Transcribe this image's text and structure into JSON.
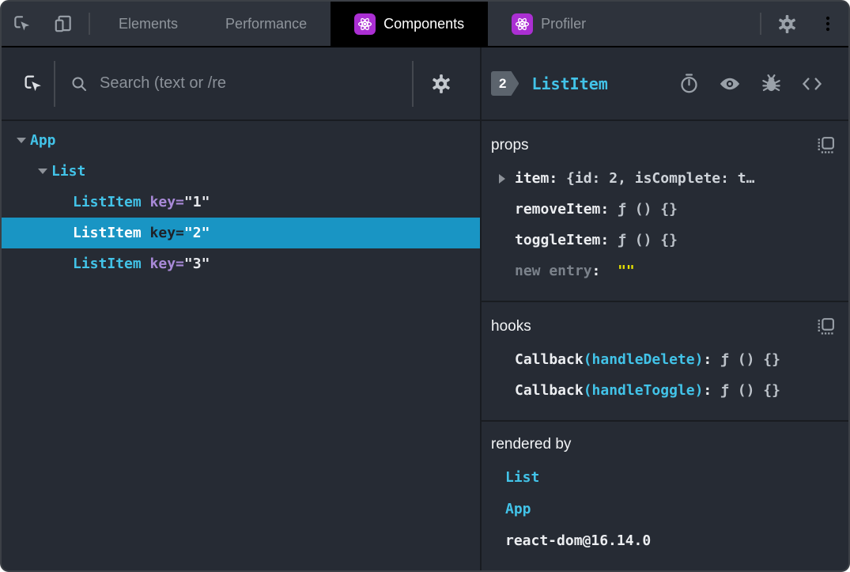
{
  "colors": {
    "panel_bg": "#262b34",
    "topbar_bg": "#2e333c",
    "active_tab_bg": "#000000",
    "selection_bg": "#1995c4",
    "component_cyan": "#42c3e8",
    "attribute_purple": "#a98ad8",
    "string_yellow": "#e9e400",
    "react_brand_purple": "#ab2fd3",
    "icon_gray": "#9aa1a9"
  },
  "topbar": {
    "icons_left": [
      "inspect-element-icon",
      "toggle-device-toolbar-icon"
    ],
    "tabs": [
      {
        "label": "Elements",
        "active": false,
        "react_icon": false
      },
      {
        "label": "Performance",
        "active": false,
        "react_icon": false
      },
      {
        "label": "Components",
        "active": true,
        "react_icon": true
      },
      {
        "label": "Profiler",
        "active": false,
        "react_icon": true
      }
    ],
    "icons_right": [
      "settings-icon",
      "more-options-icon"
    ]
  },
  "left_panel": {
    "toolbar": {
      "search_placeholder": "Search (text or /re",
      "search_value": ""
    },
    "tree": [
      {
        "name": "App",
        "depth": 0,
        "expanded": true,
        "selected": false
      },
      {
        "name": "List",
        "depth": 1,
        "expanded": true,
        "selected": false
      },
      {
        "name": "ListItem",
        "depth": 2,
        "attr": "key=",
        "value": "\"1\"",
        "selected": false
      },
      {
        "name": "ListItem",
        "depth": 2,
        "attr": "key=",
        "value": "\"2\"",
        "selected": true
      },
      {
        "name": "ListItem",
        "depth": 2,
        "attr": "key=",
        "value": "\"3\"",
        "selected": false
      }
    ]
  },
  "right_panel": {
    "header": {
      "badge": "2",
      "title": "ListItem",
      "icons": [
        "stopwatch-icon",
        "eye-icon",
        "bug-icon",
        "view-source-icon"
      ]
    },
    "sections": [
      {
        "title": "props",
        "copy_icon": true,
        "rows": [
          {
            "arrow": true,
            "parts": [
              {
                "text": "item",
                "cls": "name"
              },
              {
                "text": ": ",
                "cls": "name"
              },
              {
                "text": "{id: 2, isComplete: t…",
                "cls": "preview"
              }
            ]
          },
          {
            "arrow": false,
            "parts": [
              {
                "text": "removeItem",
                "cls": "name"
              },
              {
                "text": ": ",
                "cls": "name"
              },
              {
                "text": "ƒ () {}",
                "cls": "fn"
              }
            ]
          },
          {
            "arrow": false,
            "parts": [
              {
                "text": "toggleItem",
                "cls": "name"
              },
              {
                "text": ": ",
                "cls": "name"
              },
              {
                "text": "ƒ () {}",
                "cls": "fn"
              }
            ]
          },
          {
            "arrow": false,
            "parts": [
              {
                "text": "new entry",
                "cls": "newentry"
              },
              {
                "text": ":  ",
                "cls": "name"
              },
              {
                "text": "\"\"",
                "cls": "yellow"
              }
            ]
          }
        ]
      },
      {
        "title": "hooks",
        "copy_icon": true,
        "rows": [
          {
            "arrow": false,
            "parts": [
              {
                "text": "Callback",
                "cls": "name"
              },
              {
                "text": "(handleDelete)",
                "cls": "cyan"
              },
              {
                "text": ": ",
                "cls": "name"
              },
              {
                "text": "ƒ () {}",
                "cls": "fn"
              }
            ]
          },
          {
            "arrow": false,
            "parts": [
              {
                "text": "Callback",
                "cls": "name"
              },
              {
                "text": "(handleToggle)",
                "cls": "cyan"
              },
              {
                "text": ": ",
                "cls": "name"
              },
              {
                "text": "ƒ () {}",
                "cls": "fn"
              }
            ]
          }
        ]
      },
      {
        "title": "rendered by",
        "copy_icon": false,
        "rows": [
          {
            "arrow": false,
            "link": true,
            "parts": [
              {
                "text": "List",
                "cls": "cyan"
              }
            ]
          },
          {
            "arrow": false,
            "link": true,
            "parts": [
              {
                "text": "App",
                "cls": "cyan"
              }
            ]
          },
          {
            "arrow": false,
            "link": false,
            "parts": [
              {
                "text": "react-dom@16.14.0",
                "cls": "name"
              }
            ]
          }
        ]
      }
    ]
  }
}
